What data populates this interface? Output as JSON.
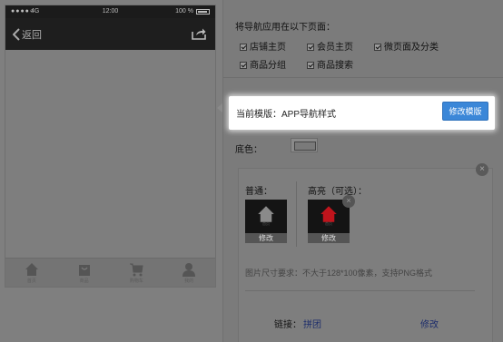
{
  "phone": {
    "status": {
      "signal": "●●●●○",
      "carrier": "4G",
      "time": "12:00",
      "battery": "100 %"
    },
    "nav": {
      "back_label": "返回"
    },
    "tabs": [
      {
        "icon": "home-icon",
        "label": "首页"
      },
      {
        "icon": "bag-icon",
        "label": "商品"
      },
      {
        "icon": "cart-icon",
        "label": "购物车"
      },
      {
        "icon": "user-icon",
        "label": "我的"
      }
    ]
  },
  "apply": {
    "title": "将导航应用在以下页面：",
    "options": [
      {
        "label": "店铺主页",
        "checked": true
      },
      {
        "label": "会员主页",
        "checked": true
      },
      {
        "label": "微页面及分类",
        "checked": true
      },
      {
        "label": "商品分组",
        "checked": true
      },
      {
        "label": "商品搜索",
        "checked": true
      }
    ]
  },
  "template": {
    "label": "当前模版：",
    "value": "APP导航样式",
    "button": "修改模版"
  },
  "background": {
    "label": "底色：",
    "color": "#7a7a7a"
  },
  "item": {
    "normal_label": "普通：",
    "highlight_label": "高亮（可选）：",
    "tile_caption": "首页",
    "tile_edit": "修改",
    "requirement": "图片尺寸要求：不大于128*100像素，支持PNG格式",
    "link_label": "链接：",
    "link_value": "拼团",
    "edit_label": "修改",
    "close_glyph": "×"
  },
  "colors": {
    "accent": "#3b87d8",
    "highlight_icon": "#c0141c",
    "link": "#1d2d6b"
  }
}
